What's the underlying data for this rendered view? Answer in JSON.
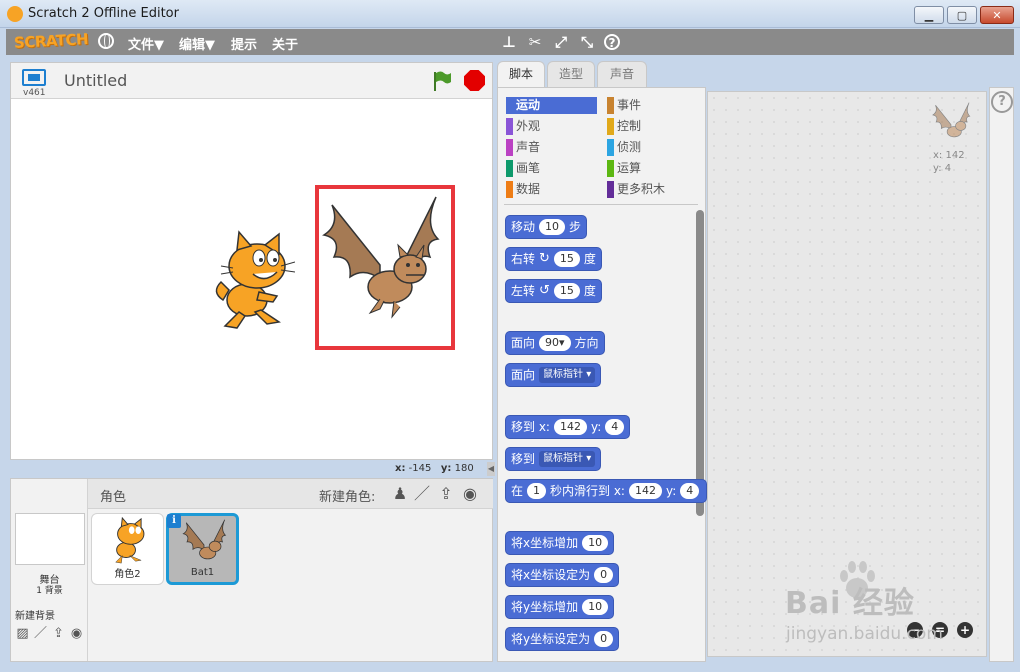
{
  "window": {
    "title": "Scratch 2 Offline Editor"
  },
  "menubar": {
    "logo": "SCRATCH",
    "items": [
      "文件▼",
      "编辑▼",
      "提示",
      "关于"
    ]
  },
  "stage": {
    "version": "v461",
    "project_title": "Untitled",
    "coords": {
      "x_label": "x:",
      "x_value": "-145",
      "y_label": "y:",
      "y_value": "180"
    }
  },
  "sprites_panel": {
    "label": "角色",
    "new_sprite_label": "新建角色:",
    "stage_name": "舞台",
    "backdrop_count": "1 背景",
    "new_backdrop_label": "新建背景",
    "sprites": [
      {
        "name": "角色2",
        "selected": false
      },
      {
        "name": "Bat1",
        "selected": true
      }
    ],
    "info_label": "i"
  },
  "tabs": [
    "脚本",
    "造型",
    "声音"
  ],
  "categories": {
    "left": [
      {
        "label": "运动",
        "color": "#4a6cd4",
        "active": true
      },
      {
        "label": "外观",
        "color": "#8a55d7"
      },
      {
        "label": "声音",
        "color": "#bb42c3"
      },
      {
        "label": "画笔",
        "color": "#0e9a6c"
      },
      {
        "label": "数据",
        "color": "#ee7d16"
      }
    ],
    "right": [
      {
        "label": "事件",
        "color": "#c88330"
      },
      {
        "label": "控制",
        "color": "#e1a91a"
      },
      {
        "label": "侦测",
        "color": "#2ca5e2"
      },
      {
        "label": "运算",
        "color": "#5cb712"
      },
      {
        "label": "更多积木",
        "color": "#632d99"
      }
    ]
  },
  "blocks": {
    "move": {
      "pre": "移动",
      "num": "10",
      "post": "步"
    },
    "turn_right": {
      "pre": "右转",
      "num": "15",
      "post": "度"
    },
    "turn_left": {
      "pre": "左转",
      "num": "15",
      "post": "度"
    },
    "point_dir": {
      "pre": "面向",
      "num": "90▾",
      "post": "方向"
    },
    "point_towards": {
      "pre": "面向",
      "drop": "鼠标指针 ▾"
    },
    "goto_xy": {
      "pre": "移到 x:",
      "x": "142",
      "mid": "y:",
      "y": "4"
    },
    "goto": {
      "pre": "移到",
      "drop": "鼠标指针 ▾"
    },
    "glide": {
      "pre": "在",
      "secs": "1",
      "mid": "秒内滑行到 x:",
      "x": "142",
      "mid2": "y:",
      "y": "4"
    },
    "change_x": {
      "pre": "将x坐标增加",
      "num": "10"
    },
    "set_x": {
      "pre": "将x坐标设定为",
      "num": "0"
    },
    "change_y": {
      "pre": "将y坐标增加",
      "num": "10"
    },
    "set_y": {
      "pre": "将y坐标设定为",
      "num": "0"
    }
  },
  "scripts_area": {
    "x_readout": "x: 142",
    "y_readout": "y: 4",
    "zoom_out": "−",
    "zoom_reset": "=",
    "zoom_in": "+"
  },
  "help": "?",
  "watermark": {
    "text": "Bai  经验",
    "url": "jingyan.baidu.com"
  }
}
